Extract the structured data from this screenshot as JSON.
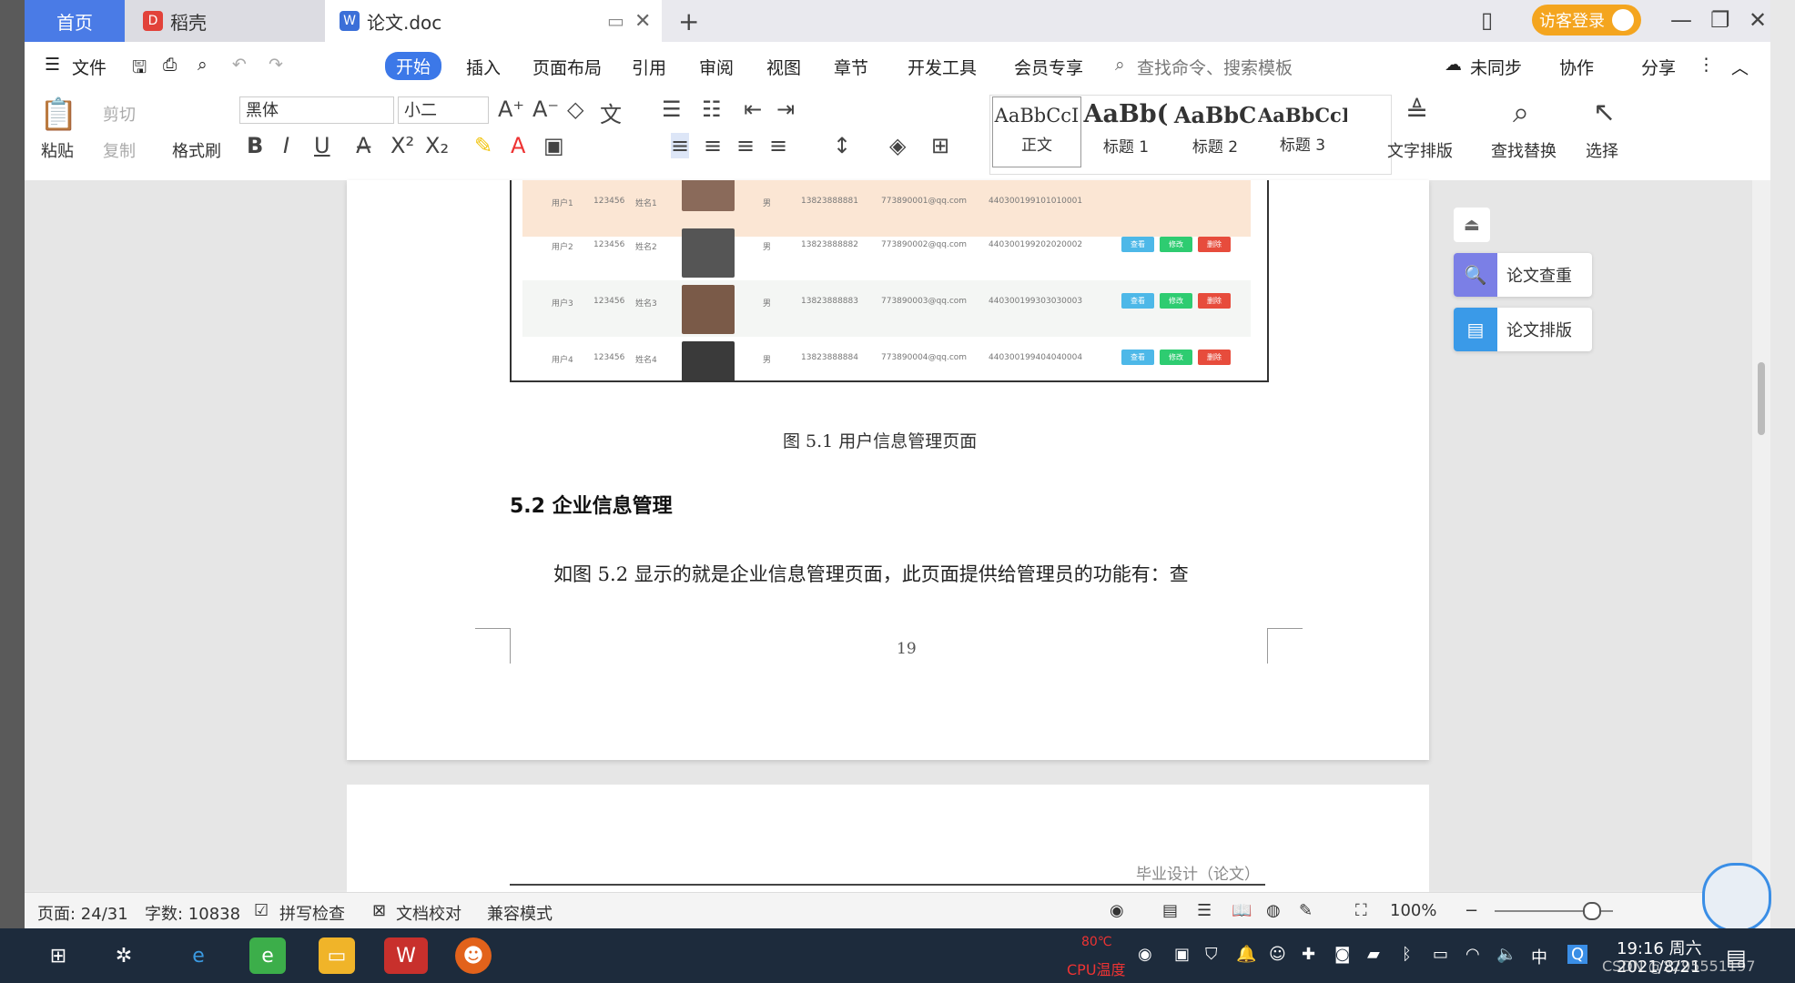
{
  "tabs": {
    "home": "首页",
    "daoke": "稻壳",
    "doc": "论文.doc",
    "new": "+"
  },
  "title_bar": {
    "login": "访客登录"
  },
  "menu": {
    "file": "文件",
    "items": [
      "开始",
      "插入",
      "页面布局",
      "引用",
      "审阅",
      "视图",
      "章节",
      "开发工具",
      "会员专享"
    ],
    "search_placeholder": "查找命令、搜索模板",
    "sync": "未同步",
    "collab": "协作",
    "share": "分享"
  },
  "ribbon": {
    "paste": "粘贴",
    "cut": "剪切",
    "copy": "复制",
    "format_painter": "格式刷",
    "font_name": "黑体",
    "font_size": "小二",
    "styles": [
      {
        "preview": "AaBbCcI",
        "label": "正文"
      },
      {
        "preview": "AaBb(",
        "label": "标题 1"
      },
      {
        "preview": "AaBbC",
        "label": "标题 2"
      },
      {
        "preview": "AaBbCcI",
        "label": "标题 3"
      }
    ],
    "text_layout": "文字排版",
    "find_replace": "查找替换",
    "select": "选择"
  },
  "figure_table": {
    "rows": [
      {
        "user": "用户1",
        "pwd": "123456",
        "name": "姓名1",
        "sex": "男",
        "phone": "13823888881",
        "email": "773890001@qq.com",
        "id": "440300199101010001"
      },
      {
        "user": "用户2",
        "pwd": "123456",
        "name": "姓名2",
        "sex": "男",
        "phone": "13823888882",
        "email": "773890002@qq.com",
        "id": "440300199202020002"
      },
      {
        "user": "用户3",
        "pwd": "123456",
        "name": "姓名3",
        "sex": "男",
        "phone": "13823888883",
        "email": "773890003@qq.com",
        "id": "440300199303030003"
      },
      {
        "user": "用户4",
        "pwd": "123456",
        "name": "姓名4",
        "sex": "男",
        "phone": "13823888884",
        "email": "773890004@qq.com",
        "id": "440300199404040004"
      }
    ],
    "actions": [
      "查看",
      "修改",
      "删除"
    ]
  },
  "document": {
    "caption": "图 5.1  用户信息管理页面",
    "section_heading": "5.2  企业信息管理",
    "paragraph": "如图 5.2 显示的就是企业信息管理页面，此页面提供给管理员的功能有：查",
    "page_number": "19",
    "next_page_header": "毕业设计（论文）"
  },
  "side_panel": {
    "check": "论文查重",
    "layout": "论文排版"
  },
  "status": {
    "page": "页面: 24/31",
    "words": "字数: 10838",
    "spell": "拼写检查",
    "proof": "文档校对",
    "compat": "兼容模式",
    "zoom": "100%"
  },
  "taskbar": {
    "temp": "80℃",
    "temp_label": "CPU温度",
    "ime": "中",
    "time": "19:16 周六",
    "date": "2021/8/21",
    "watermark": "CSDN @2295551197"
  }
}
